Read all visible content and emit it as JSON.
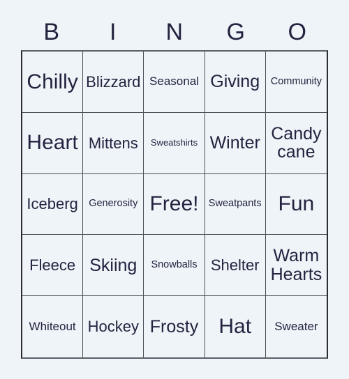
{
  "card": {
    "title": "BINGO",
    "header_letters": [
      "B",
      "I",
      "N",
      "G",
      "O"
    ],
    "text_color": "#232340",
    "page_background": "#eff4f8",
    "cell_background": "#eff4f8",
    "grid_line_color": "#4a4f59",
    "rows": 5,
    "columns": 5,
    "free_space": "Free!",
    "cells": [
      {
        "label": "Chilly",
        "size": "sz-xl",
        "row": 1,
        "column": 1
      },
      {
        "label": "Blizzard",
        "size": "sz-md",
        "row": 1,
        "column": 2
      },
      {
        "label": "Seasonal",
        "size": "sz-sm",
        "row": 1,
        "column": 3
      },
      {
        "label": "Giving",
        "size": "sz-lg",
        "row": 1,
        "column": 4
      },
      {
        "label": "Community",
        "size": "sz-xs",
        "row": 1,
        "column": 5
      },
      {
        "label": "Heart",
        "size": "sz-xl",
        "row": 2,
        "column": 1
      },
      {
        "label": "Mittens",
        "size": "sz-md",
        "row": 2,
        "column": 2
      },
      {
        "label": "Sweatshirts",
        "size": "sz-xxs",
        "row": 2,
        "column": 3
      },
      {
        "label": "Winter",
        "size": "sz-lg",
        "row": 2,
        "column": 4
      },
      {
        "label": "Candy cane",
        "size": "sz-lg",
        "row": 2,
        "column": 5
      },
      {
        "label": "Iceberg",
        "size": "sz-md",
        "row": 3,
        "column": 1
      },
      {
        "label": "Generosity",
        "size": "sz-xs",
        "row": 3,
        "column": 2
      },
      {
        "label": "Free!",
        "size": "sz-xl",
        "row": 3,
        "column": 3
      },
      {
        "label": "Sweatpants",
        "size": "sz-xs",
        "row": 3,
        "column": 4
      },
      {
        "label": "Fun",
        "size": "sz-xl",
        "row": 3,
        "column": 5
      },
      {
        "label": "Fleece",
        "size": "sz-md",
        "row": 4,
        "column": 1
      },
      {
        "label": "Skiing",
        "size": "sz-lg",
        "row": 4,
        "column": 2
      },
      {
        "label": "Snowballs",
        "size": "sz-xs",
        "row": 4,
        "column": 3
      },
      {
        "label": "Shelter",
        "size": "sz-md",
        "row": 4,
        "column": 4
      },
      {
        "label": "Warm Hearts",
        "size": "sz-lg",
        "row": 4,
        "column": 5
      },
      {
        "label": "Whiteout",
        "size": "sz-sm",
        "row": 5,
        "column": 1
      },
      {
        "label": "Hockey",
        "size": "sz-md",
        "row": 5,
        "column": 2
      },
      {
        "label": "Frosty",
        "size": "sz-lg",
        "row": 5,
        "column": 3
      },
      {
        "label": "Hat",
        "size": "sz-xl",
        "row": 5,
        "column": 4
      },
      {
        "label": "Sweater",
        "size": "sz-sm",
        "row": 5,
        "column": 5
      }
    ]
  }
}
